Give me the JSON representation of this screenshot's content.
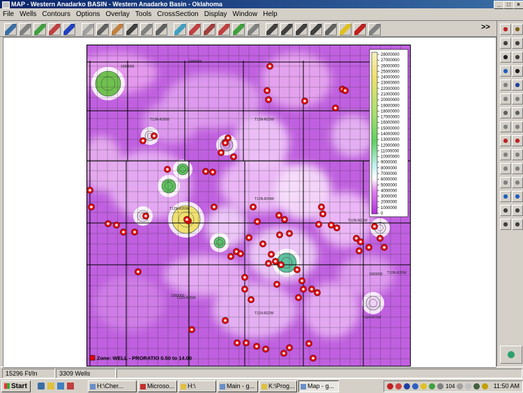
{
  "window": {
    "title": "MAP - Western Anadarko BASIN - Western Anadarko Basin - Oklahoma",
    "controls": [
      "minimize",
      "maximize",
      "close"
    ]
  },
  "menus": [
    "File",
    "Wells",
    "Contours",
    "Options",
    "Overlay",
    "Tools",
    "CrossSection",
    "Display",
    "Window",
    "Help"
  ],
  "toolbar": {
    "overflow_label": ">>",
    "icons": [
      "open-map-icon",
      "print-icon",
      "color-map-icon",
      "color-map-2-icon",
      "color-map-3-icon",
      "well-data-icon",
      "report-icon",
      "stratigraphy-icon",
      "cross-section-icon",
      "well-log-icon",
      "well-log-2-icon",
      "globe-icon",
      "filter-icon",
      "tools-icon",
      "cross-icon",
      "trend-icon",
      "select-area-icon",
      "zoom-in-icon",
      "zoom-out-icon",
      "zoom-box-icon",
      "zoom-window-icon",
      "pan-icon",
      "pencil-icon",
      "grid-icon",
      "layers-icon"
    ]
  },
  "map": {
    "legend": {
      "ticks": [
        "28000000",
        "27000000",
        "26000000",
        "25000000",
        "24000000",
        "23000000",
        "22000000",
        "21000000",
        "20000000",
        "19000000",
        "18000000",
        "17000000",
        "16000000",
        "15000000",
        "14000000",
        "13000000",
        "12000000",
        "11000000",
        "10000000",
        "9000000",
        "8000000",
        "7000000",
        "6000000",
        "5000000",
        "4000000",
        "3000000",
        "2000000",
        "1000000",
        "0"
      ],
      "colors": {
        "low": "#b030d8",
        "mid": "#ffffff",
        "green": "#50c030",
        "high": "#f0e060"
      }
    },
    "caption": "Zone: WELL - PRORATIO 0.50 to 14.00",
    "grid_labels": [
      "T13N-R26W",
      "T13N-R22W",
      "T12N-R26W",
      "T12N-R24W",
      "T12N-R23W",
      "T11N-R25W",
      "T11N-R22W",
      "T11N-R21W",
      "T10N-R20W"
    ],
    "contour_labels": [
      "1000000",
      "1000000",
      "1000000",
      "1000000"
    ]
  },
  "status": {
    "coordinates": "15296 Ft/In",
    "well_count": "3309 Wells"
  },
  "taskbar": {
    "start_label": "Start",
    "tasks": [
      "H:\\Cher...",
      "Microso...",
      "H:\\",
      "Main - g...",
      "K:\\Prog...",
      "Map - g..."
    ],
    "active_task": "Map - g...",
    "tray_number": "104",
    "clock": "11:50 AM"
  }
}
